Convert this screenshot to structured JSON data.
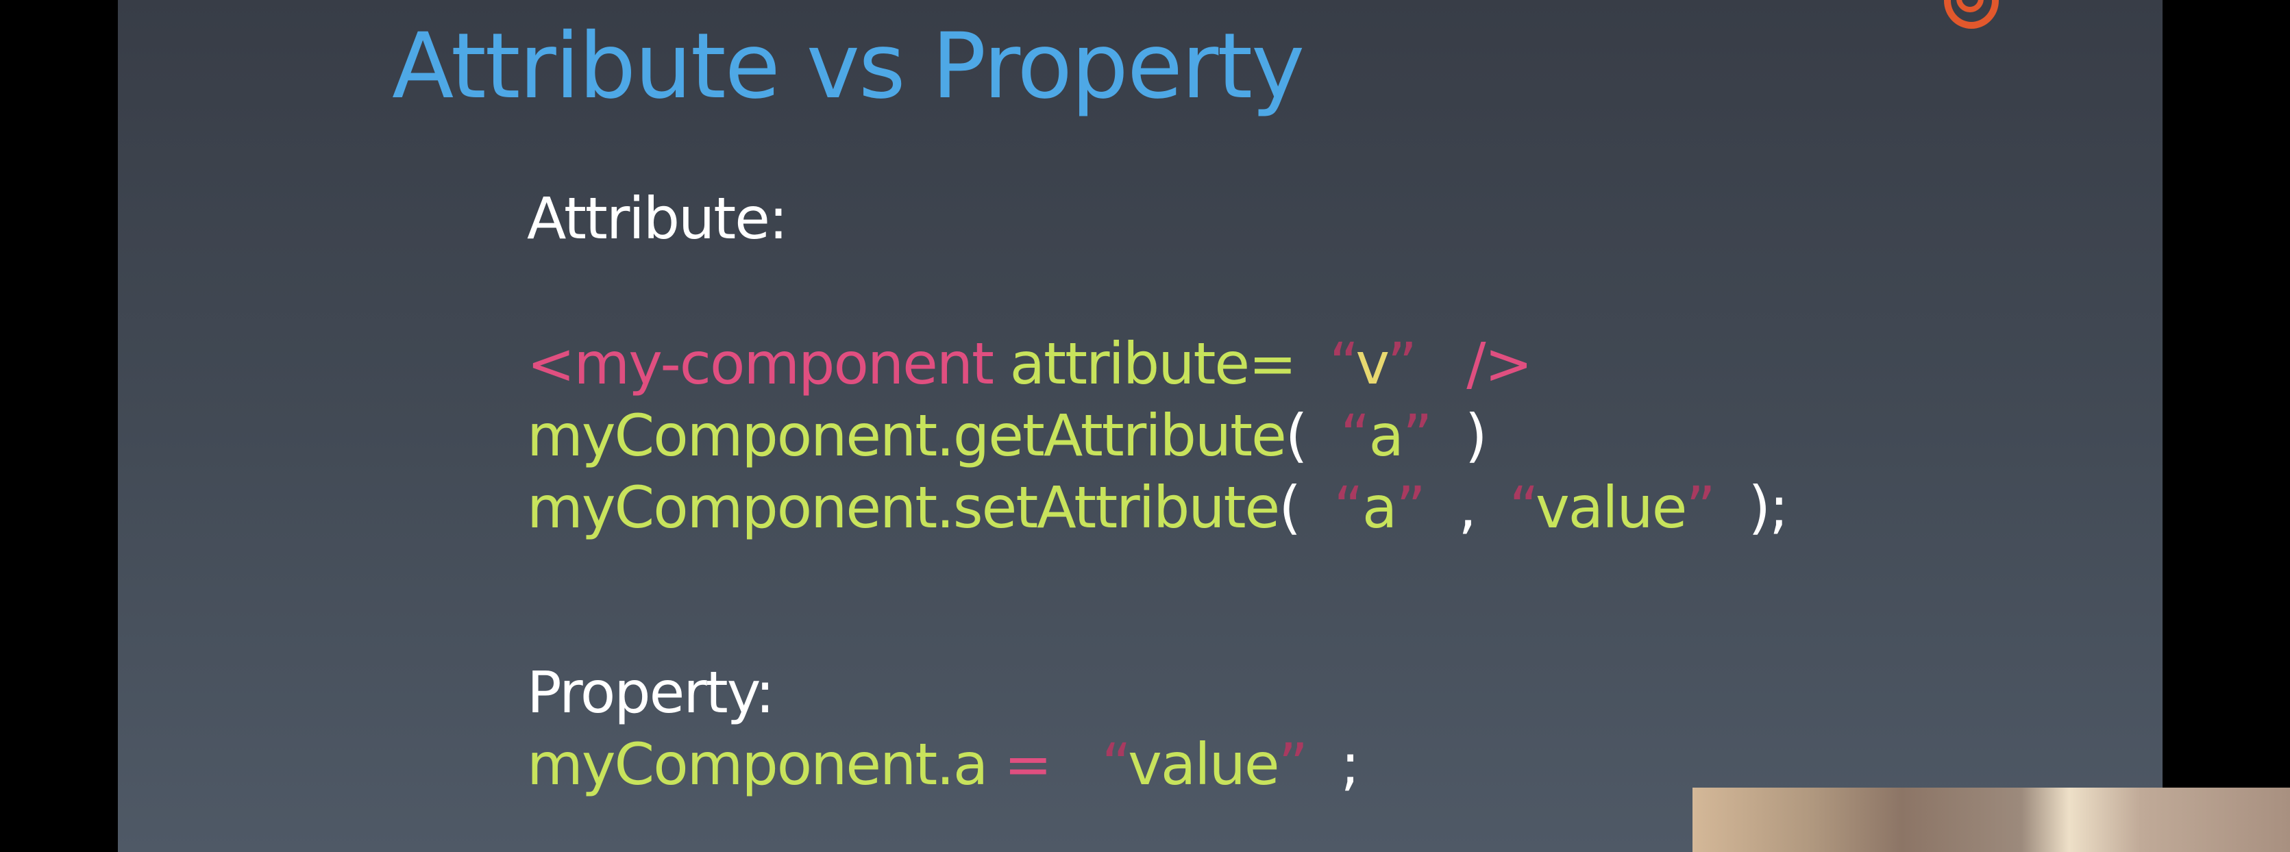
{
  "slide": {
    "title": "Attribute vs Property",
    "attribute_heading": "Attribute:",
    "code_lines": [
      {
        "tag_open": "<my-component",
        "attr": " attribute=",
        "q1": "  “",
        "val": "v",
        "q2": "”",
        "tag_close": "   />"
      },
      {
        "obj": "myComponent.getAttribute",
        "p1": "(",
        "q1": "  “",
        "arg": "a",
        "q2": "”",
        "p2": "  )"
      },
      {
        "obj": "myComponent.setAttribute",
        "p1": "(",
        "q1": "  “",
        "arg": "a",
        "q2": "”",
        "comma": "  ,  ",
        "q3": "“",
        "arg2": "value",
        "q4": "”",
        "p2": "  );"
      }
    ],
    "property_heading": "Property:",
    "property_line": {
      "obj": "myComponent.a",
      "eq": " =  ",
      "q1": " “",
      "val": "value",
      "q2": "”",
      "semi": "  ;"
    }
  },
  "colors": {
    "title": "#4ea8e6",
    "code": "#c8e35c",
    "tag": "#e04f80",
    "logo": "#e2582c"
  },
  "icons": {
    "logo": "brand-logo-icon"
  }
}
